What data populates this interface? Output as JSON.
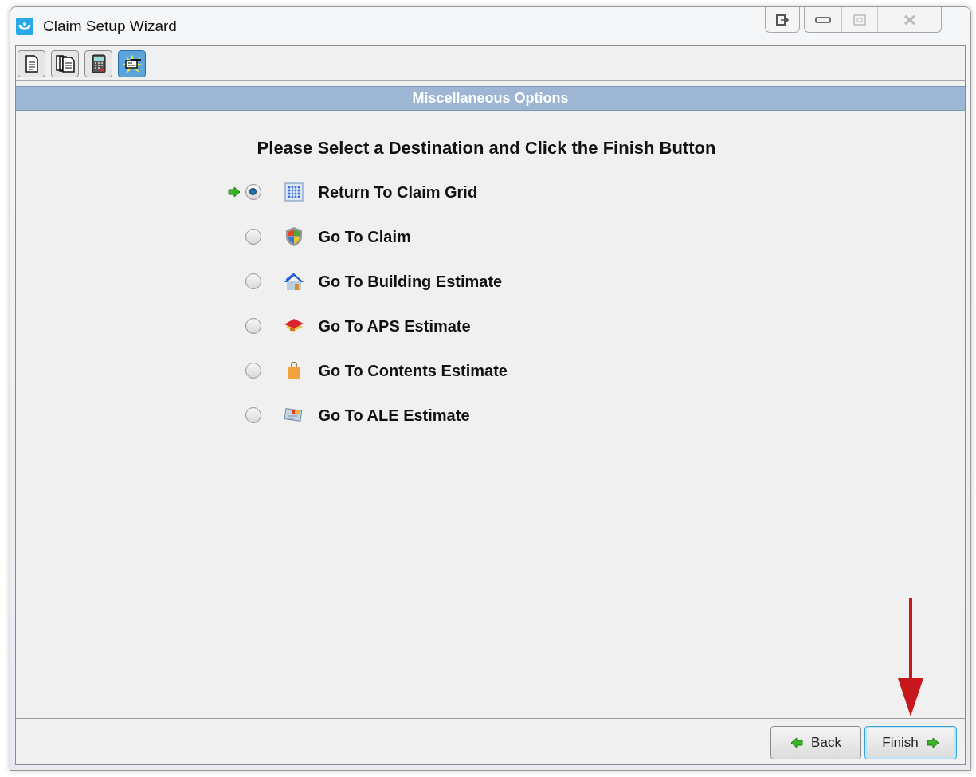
{
  "window": {
    "title": "Claim Setup Wizard"
  },
  "toolbar": [
    {
      "kind": "document",
      "selected": false
    },
    {
      "kind": "documents",
      "selected": false
    },
    {
      "kind": "calculator",
      "selected": false
    },
    {
      "kind": "wizard",
      "selected": true
    }
  ],
  "section_title": "Miscellaneous Options",
  "heading": "Please Select a Destination and Click the Finish Button",
  "options": [
    {
      "kind": "grid",
      "label": "Return To Claim Grid",
      "selected": true
    },
    {
      "kind": "shield",
      "label": "Go To Claim",
      "selected": false
    },
    {
      "kind": "house",
      "label": "Go To Building Estimate",
      "selected": false
    },
    {
      "kind": "roof",
      "label": "Go To APS Estimate",
      "selected": false
    },
    {
      "kind": "bag",
      "label": "Go To Contents Estimate",
      "selected": false
    },
    {
      "kind": "card",
      "label": "Go To ALE Estimate",
      "selected": false
    }
  ],
  "buttons": [
    {
      "kind": "back",
      "label": "Back",
      "focused": false
    },
    {
      "kind": "finish",
      "label": "Finish",
      "focused": true
    }
  ]
}
